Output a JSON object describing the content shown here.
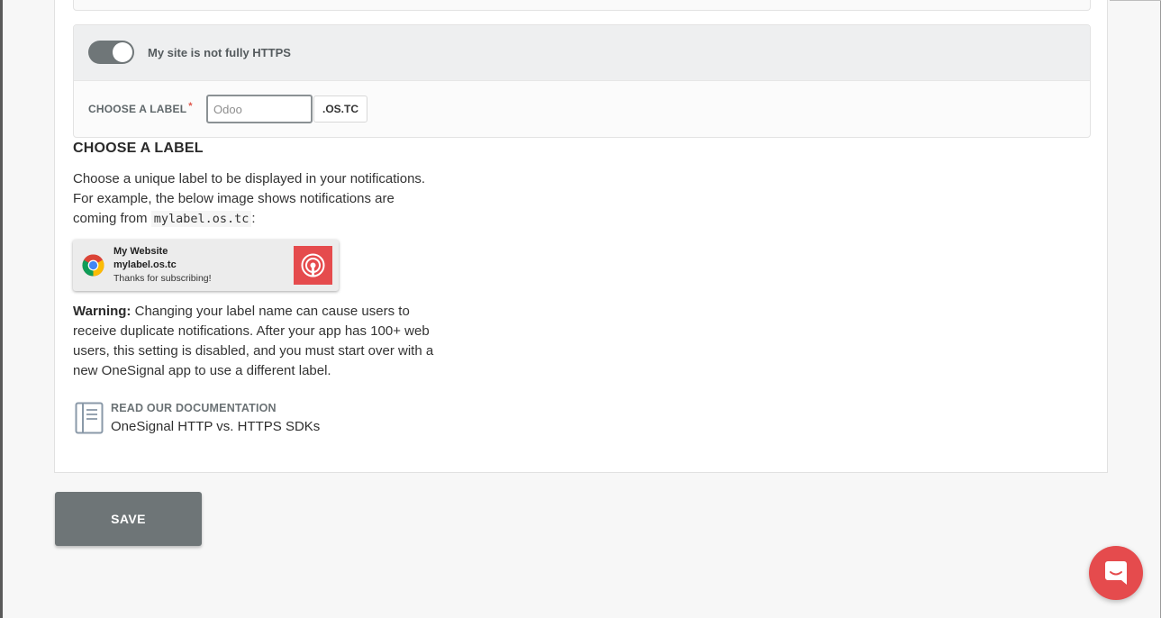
{
  "https_settings": {
    "toggle_label": "My site is not fully HTTPS",
    "toggle_on": true,
    "field_label": "CHOOSE A LABEL",
    "required_marker": "*",
    "input_value": "",
    "input_placeholder": "Odoo",
    "domain_suffix": ".OS.TC"
  },
  "help": {
    "title": "CHOOSE A LABEL",
    "text_before_code": "Choose a unique label to be displayed in your notifications. For example, the below image shows notifications are coming from ",
    "code": "mylabel.os.tc",
    "text_after_code": ":",
    "notification_preview": {
      "site_name": "My Website",
      "domain": "mylabel.os.tc",
      "message": "Thanks for subscribing!",
      "browser_icon": "chrome-icon",
      "logo_icon": "onesignal-logo-icon"
    },
    "warning_label": "Warning:",
    "warning_text": " Changing your label name can cause users to receive duplicate notifications. After your app has 100+ web users, this setting is disabled, and you must start over with a new OneSignal app to use a different label."
  },
  "documentation": {
    "heading": "READ OUR DOCUMENTATION",
    "title": "OneSignal HTTP vs. HTTPS SDKs",
    "icon": "book-icon"
  },
  "actions": {
    "save_label": "SAVE"
  },
  "chat": {
    "icon": "chat-icon"
  },
  "colors": {
    "accent_red": "#e54b4d",
    "button_gray": "#6e7577",
    "toggle_gray": "#6f7678"
  }
}
